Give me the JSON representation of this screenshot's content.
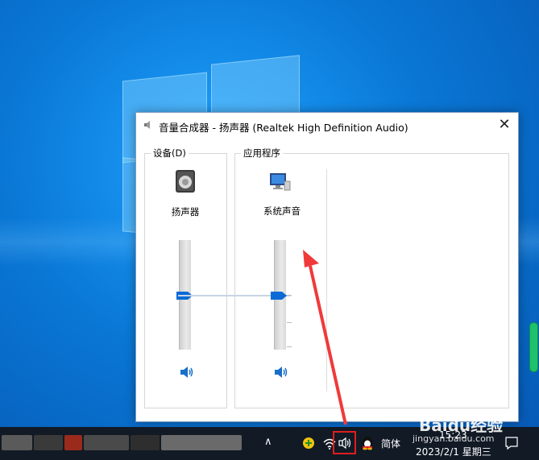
{
  "dialog": {
    "title": "音量合成器 - 扬声器 (Realtek High Definition Audio)",
    "close_glyph": "✕",
    "device_group_label": "设备(D)",
    "apps_group_label": "应用程序",
    "device": {
      "name": "扬声器",
      "volume_fraction": 0.5
    },
    "apps": [
      {
        "name": "系统声音",
        "volume_fraction": 0.5
      }
    ]
  },
  "taskbar": {
    "ime": "简体",
    "time": "15:23",
    "date": "2023/2/1 星期三",
    "show_hidden_glyph": "∧",
    "icons": [
      "plus-icon",
      "wifi-icon",
      "speaker-icon",
      "qq-penguin-icon",
      "notification-icon"
    ],
    "highlight_color": "#e01e1e"
  },
  "watermark": {
    "brand": "Baidu经验",
    "url": "jingyan.baidu.com"
  },
  "colors": {
    "accent": "#0a6ad6",
    "arrow": "#f03a3a",
    "desktop": "#0a78d6"
  }
}
